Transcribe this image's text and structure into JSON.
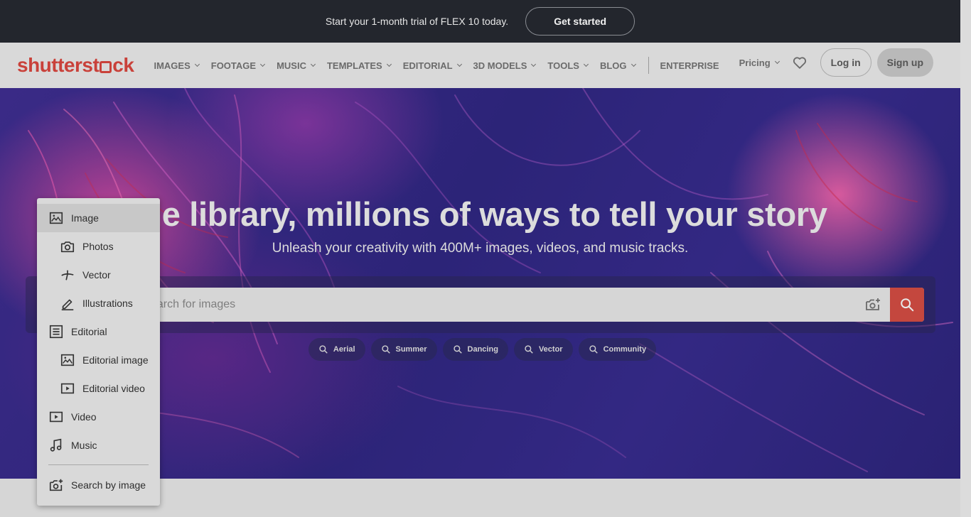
{
  "promo": {
    "text": "Start your 1-month trial of FLEX 10 today.",
    "button": "Get started"
  },
  "header": {
    "logo": {
      "part1": "shutterst",
      "part2": "ck"
    },
    "nav": [
      {
        "label": "IMAGES",
        "has_menu": true
      },
      {
        "label": "FOOTAGE",
        "has_menu": true
      },
      {
        "label": "MUSIC",
        "has_menu": true
      },
      {
        "label": "TEMPLATES",
        "has_menu": true
      },
      {
        "label": "EDITORIAL",
        "has_menu": true
      },
      {
        "label": "3D MODELS",
        "has_menu": true
      },
      {
        "label": "TOOLS",
        "has_menu": true
      },
      {
        "label": "BLOG",
        "has_menu": true
      }
    ],
    "enterprise": "ENTERPRISE",
    "pricing": "Pricing",
    "login": "Log in",
    "signup": "Sign up"
  },
  "hero": {
    "title": "ne library, millions of ways to tell your story",
    "subtitle": "Unleash your creativity with 400M+ images, videos, and music tracks.",
    "search_placeholder": "earch for images",
    "chips": [
      "Aerial",
      "Summer",
      "Dancing",
      "Vector",
      "Community"
    ]
  },
  "dropdown": {
    "items": [
      {
        "label": "Image",
        "icon": "image-icon",
        "level": "top",
        "selected": true
      },
      {
        "label": "Photos",
        "icon": "camera-icon",
        "level": "sub",
        "selected": false
      },
      {
        "label": "Vector",
        "icon": "vector-icon",
        "level": "sub",
        "selected": false
      },
      {
        "label": "Illustrations",
        "icon": "pen-icon",
        "level": "sub",
        "selected": false
      },
      {
        "label": "Editorial",
        "icon": "document-icon",
        "level": "top",
        "selected": false
      },
      {
        "label": "Editorial image",
        "icon": "image-icon",
        "level": "sub",
        "selected": false
      },
      {
        "label": "Editorial video",
        "icon": "play-icon",
        "level": "sub",
        "selected": false
      },
      {
        "label": "Video",
        "icon": "play-icon",
        "level": "top",
        "selected": false
      },
      {
        "label": "Music",
        "icon": "music-note-icon",
        "level": "top",
        "selected": false
      }
    ],
    "search_by_image": {
      "label": "Search by image",
      "icon": "camera-plus-icon"
    }
  },
  "colors": {
    "brand_red": "#c9413a",
    "promo_bg": "#23262d",
    "hero_purple": "#2c2478"
  }
}
